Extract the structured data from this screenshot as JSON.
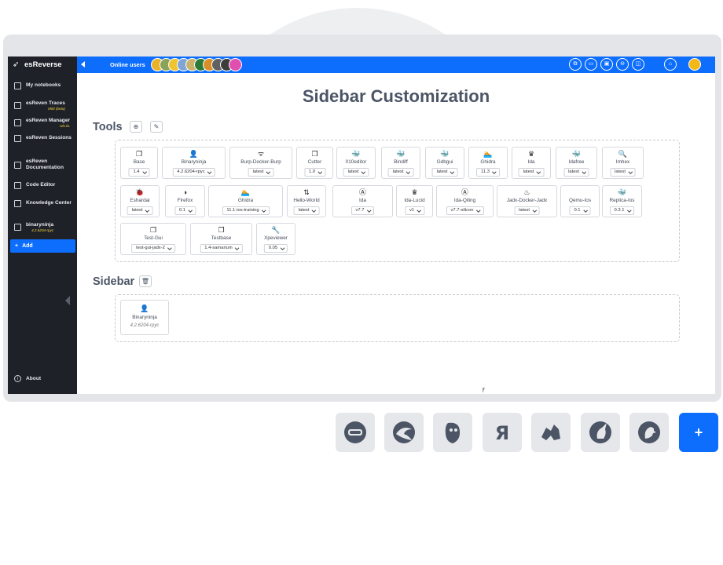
{
  "app": {
    "name": "esReverse"
  },
  "topbar": {
    "online_label": "Online users",
    "avatar_colors": [
      "#e8b32b",
      "#8aa35a",
      "#f0c330",
      "#7ea5d6",
      "#c9b26a",
      "#2c7a3a",
      "#d88f2b",
      "#616161",
      "#3c3c3c",
      "#e04fb0"
    ]
  },
  "sidebar": {
    "items": [
      {
        "label": "My notebooks",
        "icon": "notebook-icon"
      },
      {
        "label": "esReven Traces",
        "sub": "Mild (beta)",
        "icon": "traces-icon"
      },
      {
        "label": "esReven Manager",
        "sub": "Ulo.kL",
        "icon": "cube-icon"
      },
      {
        "label": "esReven Sessions",
        "icon": "sessions-icon"
      },
      {
        "label": "esReven Documentation",
        "icon": "documentation-icon"
      },
      {
        "label": "Code Editor",
        "icon": "code-icon"
      },
      {
        "label": "Knowledge Center",
        "icon": "graduation-cap-icon"
      },
      {
        "label": "binaryninja",
        "sub": "4.2.6204-rpyc",
        "icon": "binaryninja-icon"
      }
    ],
    "add_label": "Add",
    "about_label": "About"
  },
  "main": {
    "title": "Sidebar Customization",
    "tools_title": "Tools",
    "sidebar_title": "Sidebar",
    "tools": [
      {
        "name": "Base",
        "value": "1.4"
      },
      {
        "name": "Binaryninja",
        "value": "4.2.6204-rpyc"
      },
      {
        "name": "Burp-Docker-Burp",
        "value": "latest"
      },
      {
        "name": "Cutter",
        "value": "1.0"
      },
      {
        "name": "010editor",
        "value": "latest"
      },
      {
        "name": "Bindiff",
        "value": "latest"
      },
      {
        "name": "Gdbgui",
        "value": "latest"
      },
      {
        "name": "Ghidra",
        "value": "11.3"
      },
      {
        "name": "Ida",
        "value": "latest"
      },
      {
        "name": "Idafree",
        "value": "latest"
      },
      {
        "name": "Imhex",
        "value": "latest"
      },
      {
        "name": "Eshardai",
        "value": "latest"
      },
      {
        "name": "Firefox",
        "value": "0.1"
      },
      {
        "name": "Ghidra",
        "value": "11.1-ios-training"
      },
      {
        "name": "Hello-World",
        "value": "latest"
      },
      {
        "name": "Ida",
        "value": "v7.7"
      },
      {
        "name": "Ida-Lucid",
        "value": "v1"
      },
      {
        "name": "Ida-Qiling",
        "value": "v7.7-silicon"
      },
      {
        "name": "Jadx-Docker-Jadx",
        "value": "latest"
      },
      {
        "name": "Qemu-Ios",
        "value": "0.1"
      },
      {
        "name": "Replica-Ios",
        "value": "0.3.1"
      },
      {
        "name": "Test-Gui",
        "value": "test-gui-jadx-2"
      },
      {
        "name": "Testbase",
        "value": "1.4-samarium"
      },
      {
        "name": "Xpeviewer",
        "value": "0.05"
      }
    ],
    "sidebar_tools": [
      {
        "name": "Binaryninja",
        "value": "4.2.6204-rpyc"
      }
    ]
  },
  "showcase": {
    "plus_label": "+",
    "logos": [
      "ida-logo-icon",
      "dragon-logo-icon",
      "pirate-logo-icon",
      "radare-logo-icon",
      "lion-logo-icon",
      "unicorn-logo-icon",
      "bird-logo-icon"
    ]
  }
}
